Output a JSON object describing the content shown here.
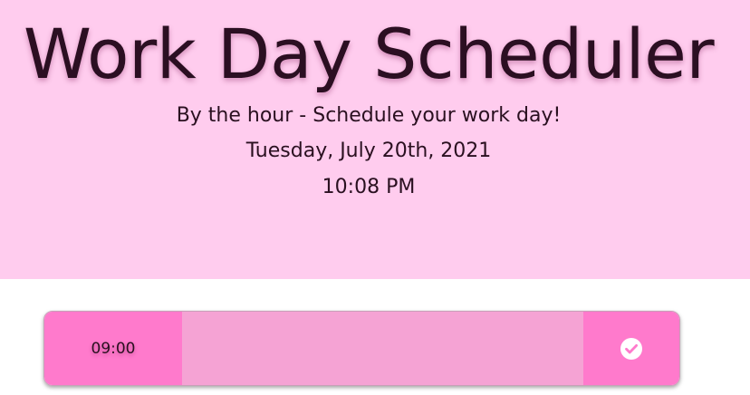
{
  "header": {
    "title": "Work Day Scheduler",
    "subtitle": "By the hour - Schedule your work day!",
    "current_date": "Tuesday, July 20th, 2021",
    "current_time": "10:08 PM"
  },
  "schedule": {
    "rows": [
      {
        "hour": "09:00",
        "event_text": "",
        "save_icon": "check-circle-icon"
      }
    ]
  },
  "colors": {
    "header_bg": "#ffccee",
    "hour_bg": "#ff7acc",
    "event_bg": "#f5a3d4",
    "save_bg": "#ff7acc"
  }
}
